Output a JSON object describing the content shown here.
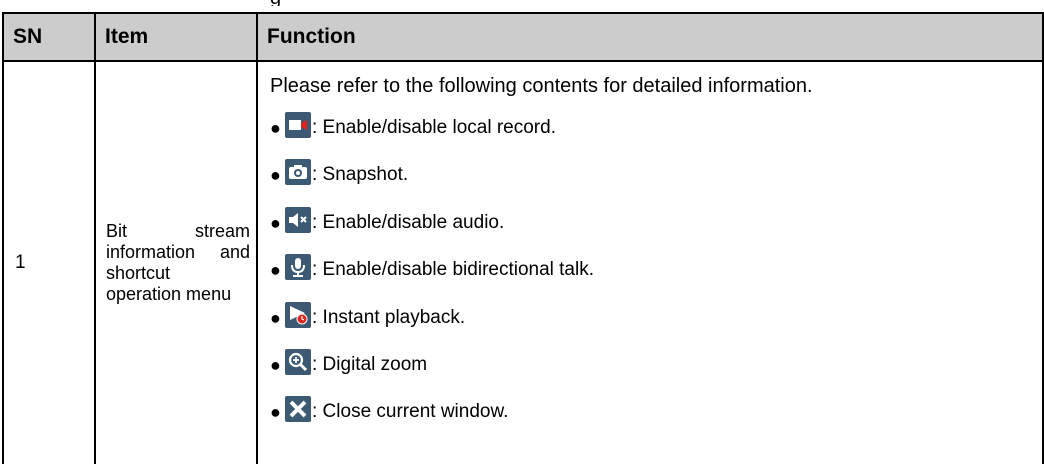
{
  "fragment_text": "g",
  "table": {
    "headers": {
      "sn": "SN",
      "item": "Item",
      "function": "Function"
    },
    "row": {
      "sn": "1",
      "item": "Bit stream information and shortcut operation menu",
      "intro": "Please refer to the following contents for detailed information.",
      "bullet": "●",
      "functions": [
        {
          "icon": "record-icon",
          "label": ": Enable/disable local record."
        },
        {
          "icon": "snapshot-icon",
          "label": ": Snapshot."
        },
        {
          "icon": "audio-icon",
          "label": ": Enable/disable audio."
        },
        {
          "icon": "microphone-icon",
          "label": ": Enable/disable bidirectional talk."
        },
        {
          "icon": "instant-playback-icon",
          "label": ": Instant playback."
        },
        {
          "icon": "digital-zoom-icon",
          "label": ": Digital zoom"
        },
        {
          "icon": "close-window-icon",
          "label": ": Close current window."
        }
      ]
    }
  },
  "colors": {
    "header_bg": "#cccccc",
    "icon_bg": "#3c5a74",
    "icon_red": "#e0241a",
    "icon_fg": "#ffffff"
  }
}
